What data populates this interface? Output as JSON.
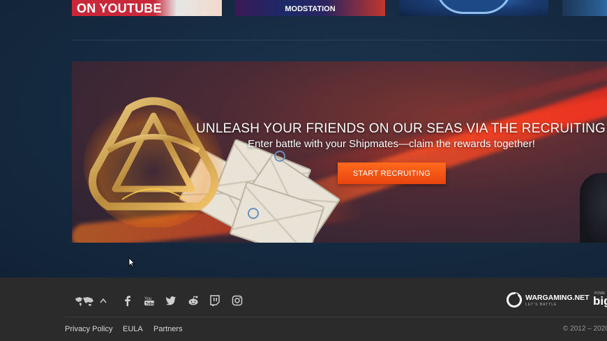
{
  "thumbnails": [
    {
      "label": "ON YOUTUBE"
    },
    {
      "label": "MODSTATION"
    },
    {
      "label": ""
    },
    {
      "label": ""
    }
  ],
  "promo": {
    "title": "UNLEASH YOUR FRIENDS ON OUR SEAS VIA THE RECRUITING STATION",
    "subtitle": "Enter battle with your Shipmates—claim the rewards together!",
    "cta_label": "START RECRUITING",
    "cta_color": "#ff5a1a"
  },
  "footer": {
    "region_icon": "world-map-icon",
    "social_icons": [
      "facebook-icon",
      "youtube-icon",
      "twitter-icon",
      "reddit-icon",
      "twitch-icon",
      "instagram-icon"
    ],
    "links": [
      "Privacy Policy",
      "EULA",
      "Partners"
    ],
    "brand": "WARGAMING.NET",
    "brand_tagline": "LET'S BATTLE",
    "powered_text": "POWE",
    "powered_brand": "big",
    "copyright": "© 2012 – 2020"
  }
}
